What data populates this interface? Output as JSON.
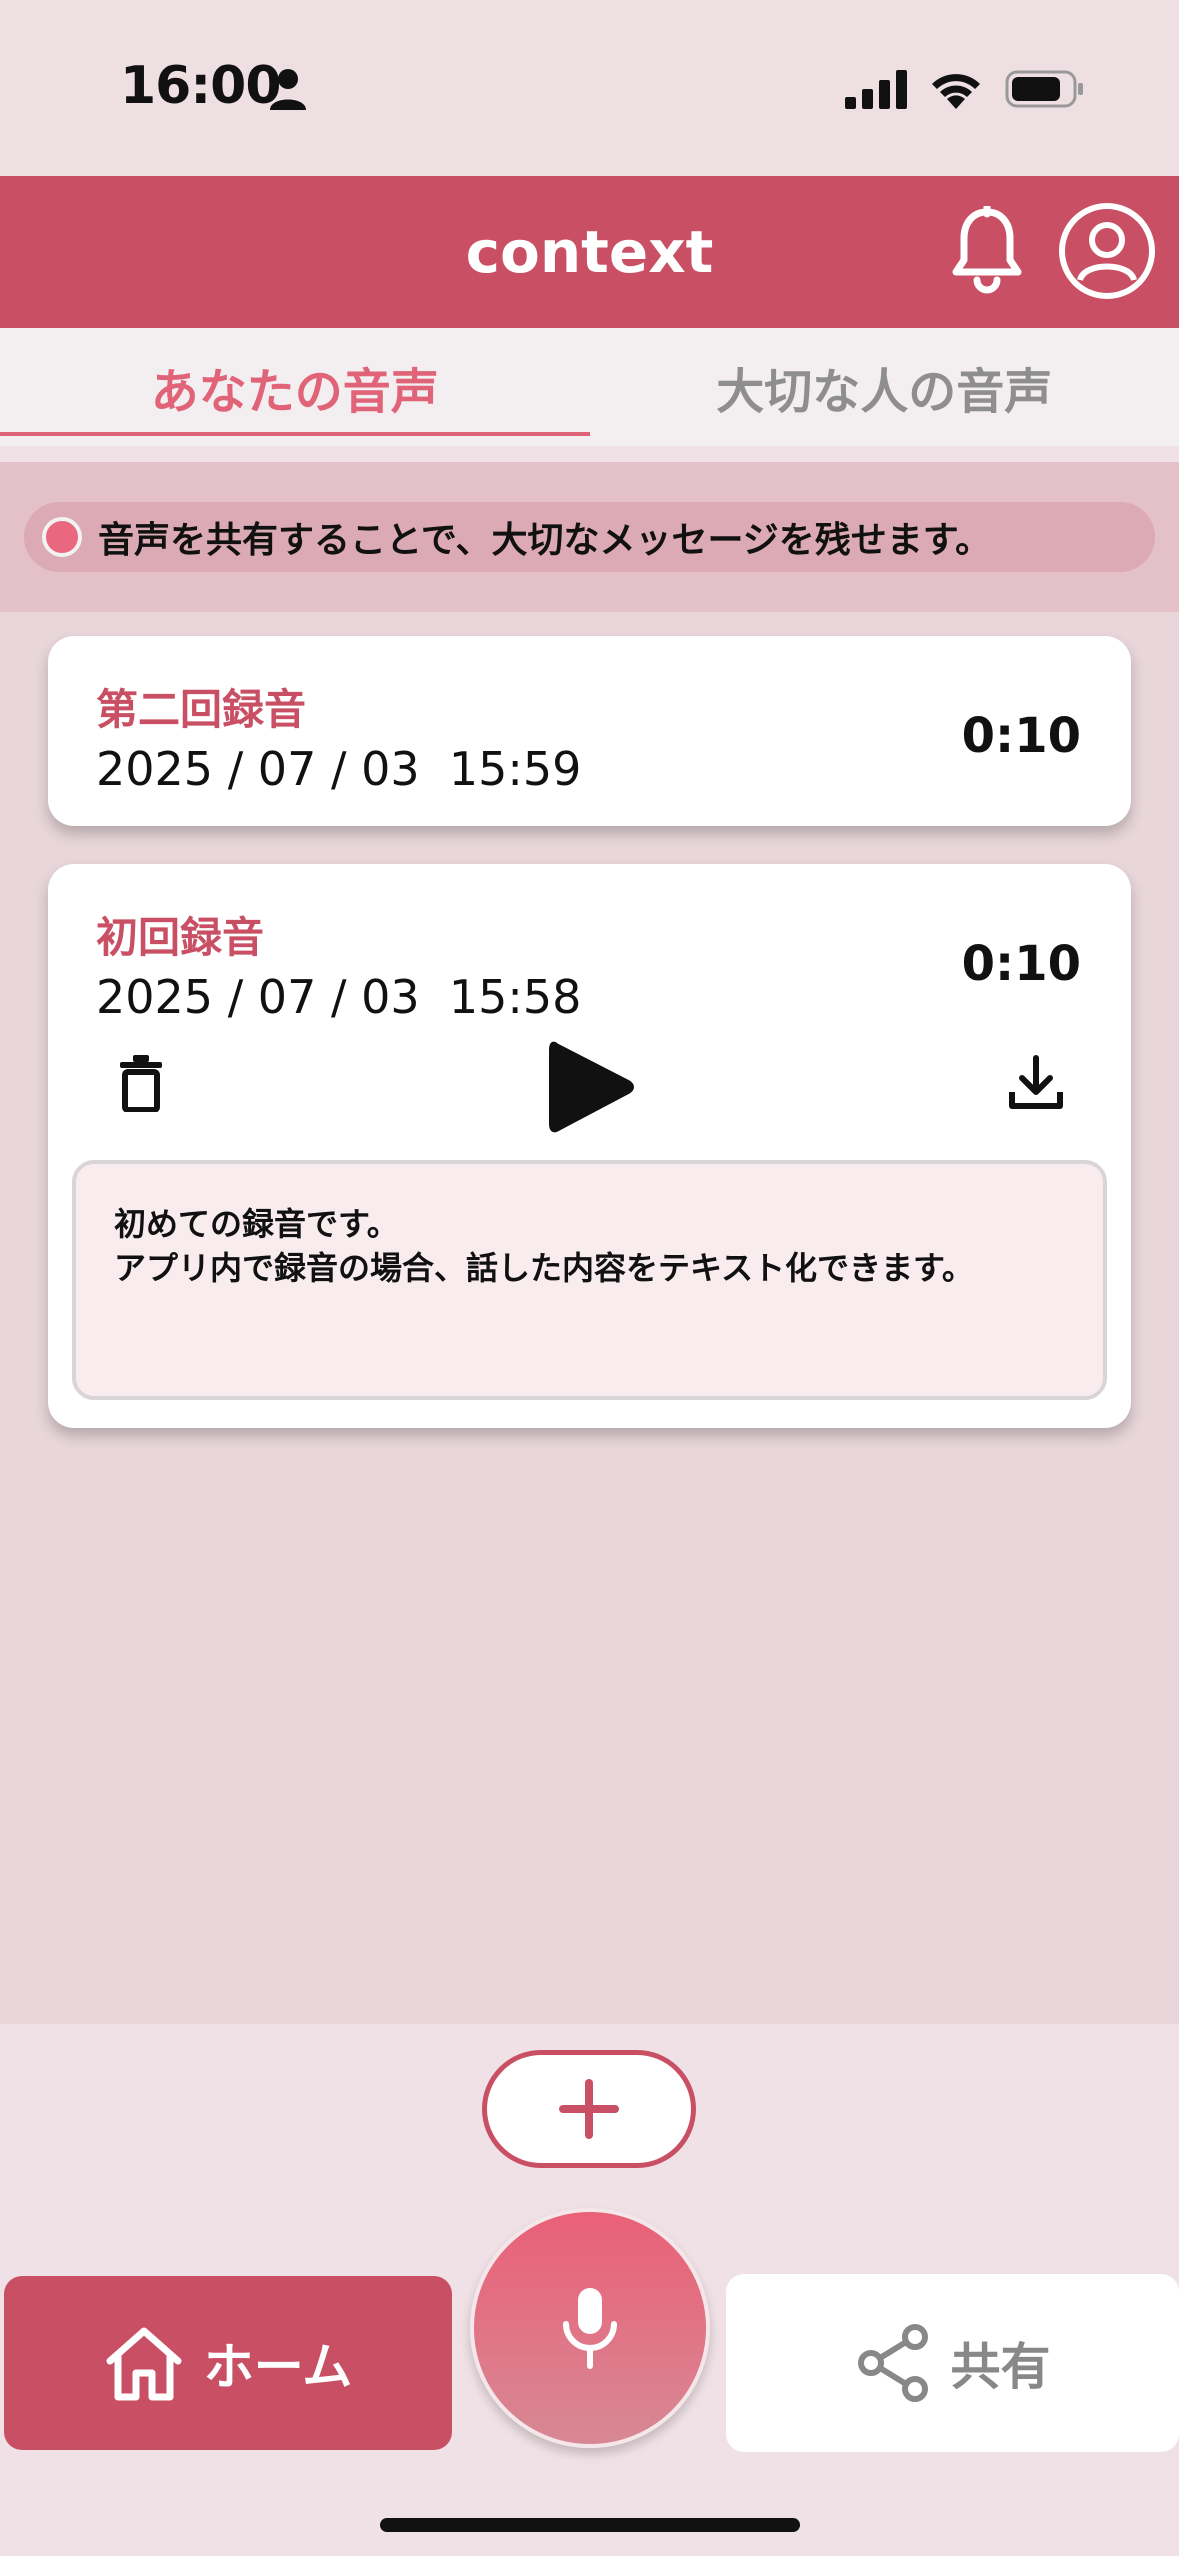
{
  "status_bar": {
    "time": "16:00"
  },
  "header": {
    "title": "context"
  },
  "tabs": [
    {
      "label": "あなたの音声",
      "active": true
    },
    {
      "label": "大切な人の音声",
      "active": false
    }
  ],
  "notice": {
    "text": "音声を共有することで、大切なメッセージを残せます。"
  },
  "recordings": [
    {
      "title": "第二回録音",
      "date": "2025 / 07 / 03  15:59",
      "duration": "0:10"
    },
    {
      "title": "初回録音",
      "date": "2025 / 07 / 03  15:58",
      "duration": "0:10",
      "transcript": [
        "初めての録音です。",
        "アプリ内で録音の場合、話した内容をテキスト化できます。"
      ]
    }
  ],
  "bottom_nav": {
    "home_label": "ホーム",
    "share_label": "共有"
  },
  "colors": {
    "accent": "#c94f64",
    "tab_active": "#e06378",
    "background": "#e8d6da"
  },
  "icons": [
    "person-icon",
    "signal-icon",
    "wifi-icon",
    "battery-icon",
    "bell-icon",
    "profile-icon",
    "trash-icon",
    "play-icon",
    "download-icon",
    "plus-icon",
    "home-icon",
    "mic-icon",
    "share-icon"
  ]
}
